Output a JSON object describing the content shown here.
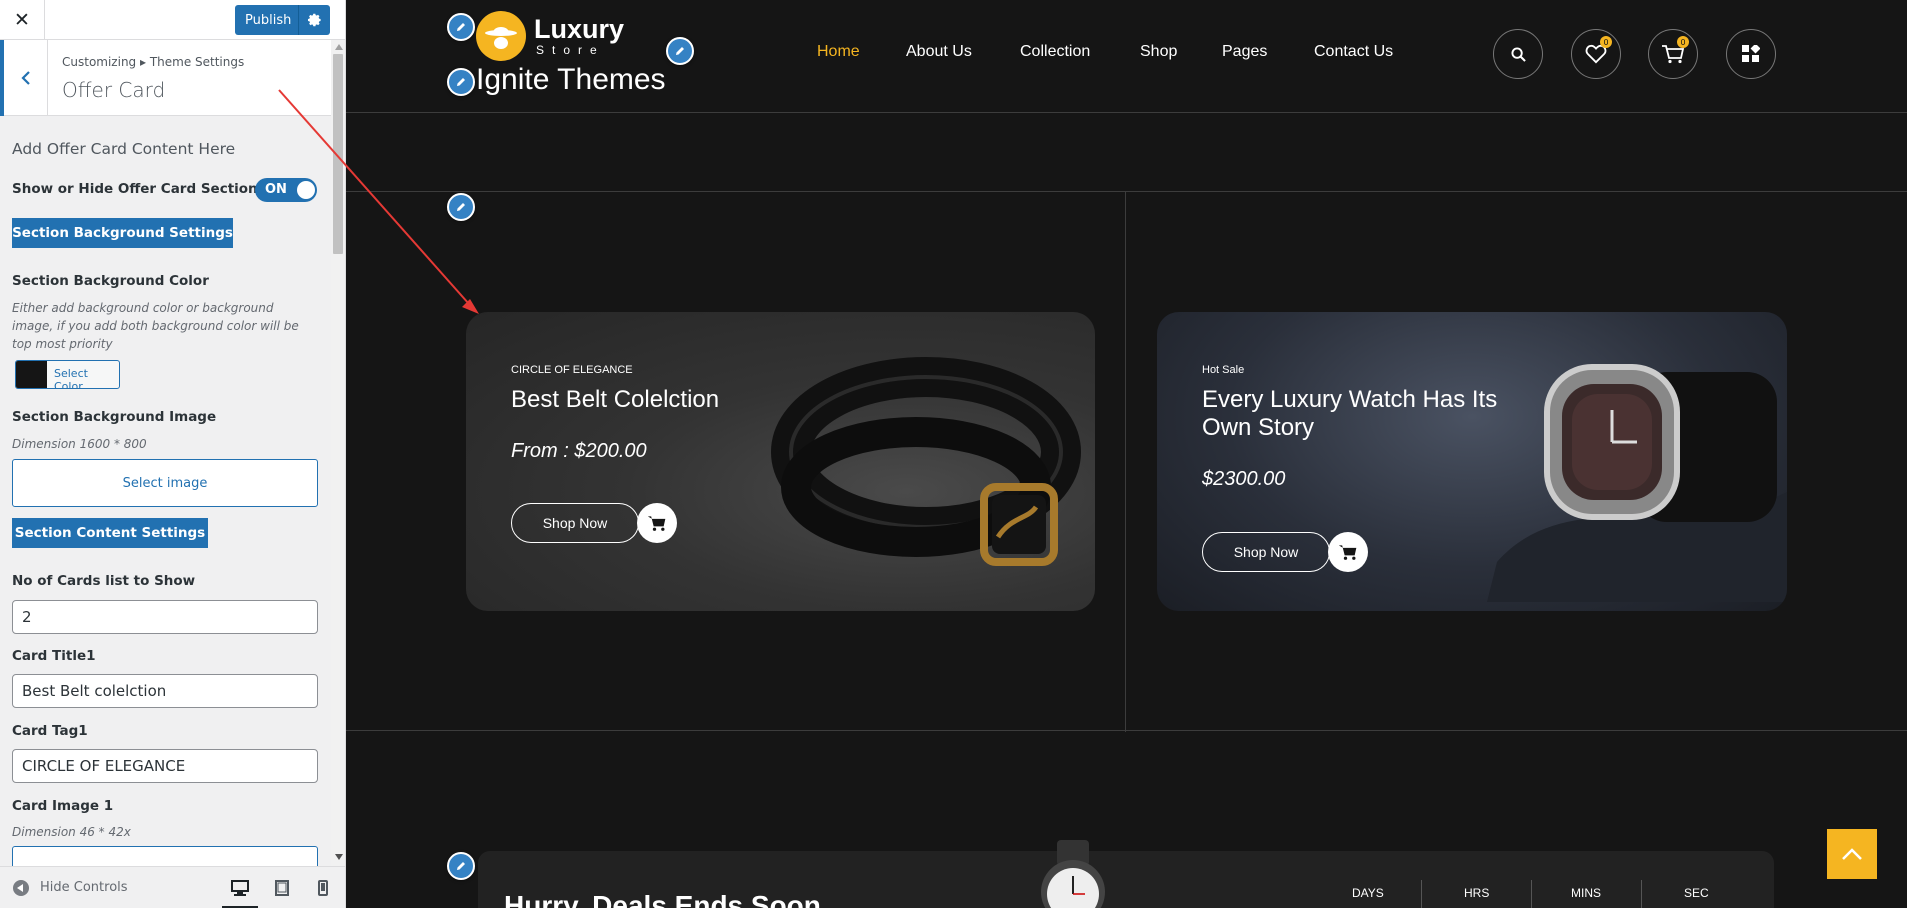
{
  "customizer": {
    "close_label": "✕",
    "publish_label": "Publish",
    "breadcrumb": "Customizing ▸ Theme Settings",
    "panel_title": "Offer Card",
    "section_heading": "Add Offer Card Content Here",
    "show_hide_label": "Show or Hide Offer Card Section",
    "toggle_state": "ON",
    "bg_settings_button": "Section Background Settings",
    "bg_color_label": "Section Background Color",
    "bg_color_desc": "Either add background color or background image, if you add both background color will be top most priority",
    "bg_color_value": "#151515",
    "select_color_label": "Select Color",
    "bg_image_label": "Section Background Image",
    "bg_image_dimension": "Dimension 1600 * 800",
    "select_image_label": "Select image",
    "content_settings_button": "Section Content Settings",
    "cards_count_label": "No of Cards list to Show",
    "cards_count_value": "2",
    "card_title1_label": "Card Title1",
    "card_title1_value": "Best Belt colelction",
    "card_tag1_label": "Card Tag1",
    "card_tag1_value": "CIRCLE OF ELEGANCE",
    "card_image1_label": "Card Image 1",
    "card_image1_dimension": "Dimension 46 * 42x",
    "hide_controls_label": "Hide Controls",
    "accent_color": "#2271b1"
  },
  "site": {
    "logo_word": "Luxury",
    "logo_sub": "Store",
    "title": "Ignite Themes",
    "accent_color": "#f5b521",
    "nav": [
      {
        "label": "Home"
      },
      {
        "label": "About Us"
      },
      {
        "label": "Collection"
      },
      {
        "label": "Shop"
      },
      {
        "label": "Pages"
      },
      {
        "label": "Contact Us"
      }
    ],
    "wishlist_count": "0",
    "cart_count": "0"
  },
  "offer_cards": [
    {
      "tag": "CIRCLE OF ELEGANCE",
      "title": "Best Belt Colelction",
      "price": "From : $200.00",
      "button": "Shop Now"
    },
    {
      "tag": "Hot Sale",
      "title": "Every Luxury Watch Has Its Own Story",
      "price": "$2300.00",
      "button": "Shop Now"
    }
  ],
  "deal": {
    "title": "Hurry, Deals Ends Soon",
    "countdown_labels": [
      "DAYS",
      "HRS",
      "MINS",
      "SEC"
    ]
  }
}
